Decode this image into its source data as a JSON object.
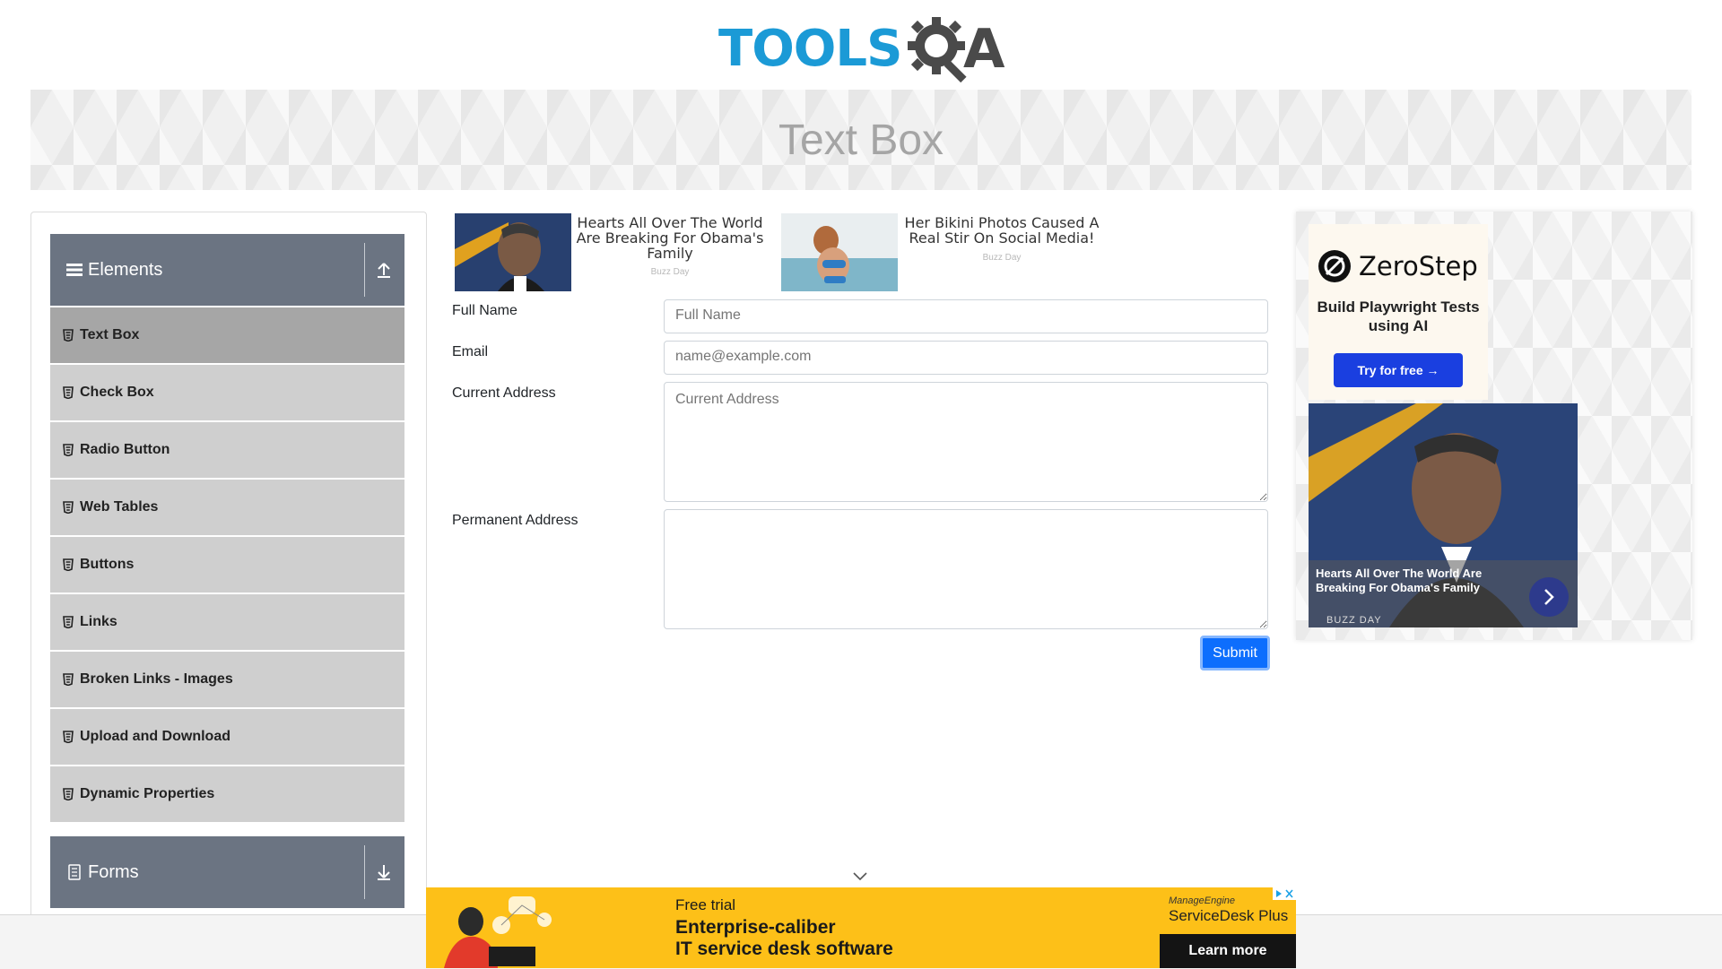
{
  "header": {
    "logo_primary": "TOOLS",
    "logo_secondary": "A"
  },
  "banner": {
    "title": "Text Box"
  },
  "sidebar": {
    "groups": [
      {
        "label": "Elements",
        "expanded": true,
        "items": [
          {
            "label": "Text Box",
            "active": true
          },
          {
            "label": "Check Box"
          },
          {
            "label": "Radio Button"
          },
          {
            "label": "Web Tables"
          },
          {
            "label": "Buttons"
          },
          {
            "label": "Links"
          },
          {
            "label": "Broken Links - Images"
          },
          {
            "label": "Upload and Download"
          },
          {
            "label": "Dynamic Properties"
          }
        ]
      },
      {
        "label": "Forms",
        "expanded": false
      }
    ]
  },
  "ads": {
    "top": [
      {
        "title": "Hearts All Over The World Are Breaking For Obama's Family",
        "source": "Buzz Day"
      },
      {
        "title": "Her Bikini Photos Caused A Real Stir On Social Media!",
        "source": "Buzz Day"
      }
    ],
    "right": {
      "brand": "ZeroStep",
      "tagline": "Build Playwright Tests using AI",
      "cta": "Try for free →",
      "story_title": "Hearts All Over The World Are Breaking For Obama's Family",
      "story_source": "BUZZ DAY"
    },
    "bottom": {
      "eyebrow": "Free trial",
      "line1": "Enterprise-caliber",
      "line2": "IT service desk software",
      "brand_top": "ManageEngine",
      "brand_bottom": "ServiceDesk Plus",
      "cta": "Learn more"
    }
  },
  "form": {
    "full_name": {
      "label": "Full Name",
      "placeholder": "Full Name",
      "value": ""
    },
    "email": {
      "label": "Email",
      "placeholder": "name@example.com",
      "value": ""
    },
    "current_address": {
      "label": "Current Address",
      "placeholder": "Current Address",
      "value": ""
    },
    "permanent_address": {
      "label": "Permanent Address",
      "placeholder": "",
      "value": ""
    },
    "submit_label": "Submit"
  },
  "colors": {
    "accent": "#0d6efd",
    "sidebar_header": "#6b7482",
    "menu_item": "#cfcfcf",
    "menu_active": "#a6a6a6",
    "logo_blue": "#1b9ad6"
  }
}
